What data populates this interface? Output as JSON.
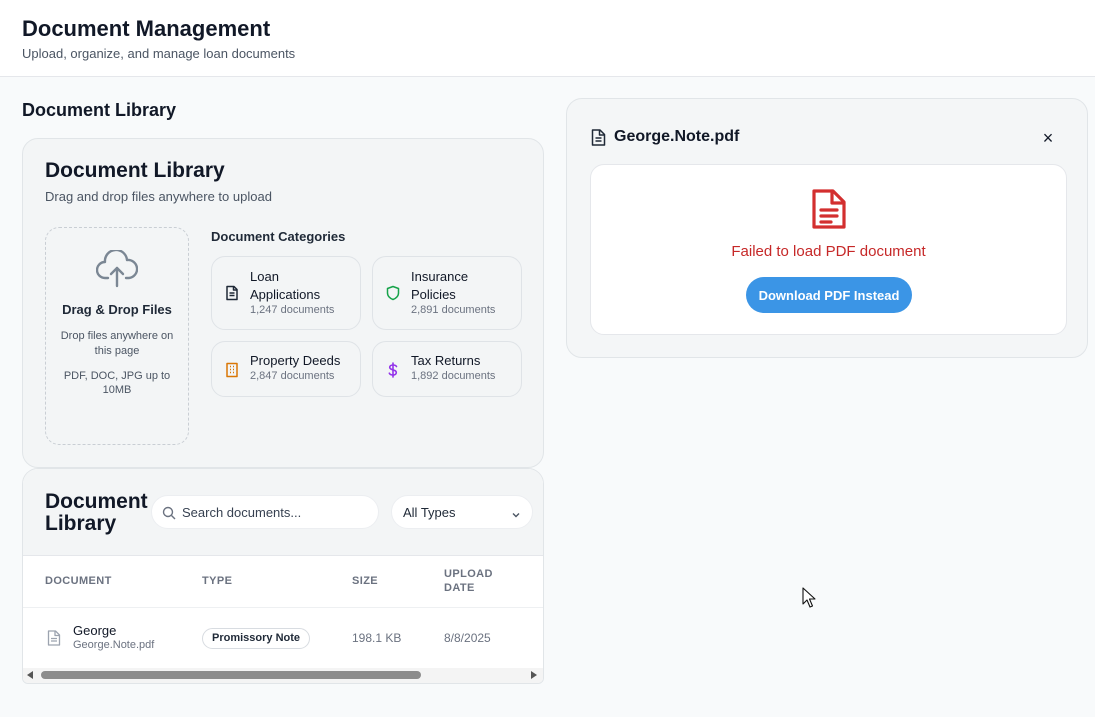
{
  "header": {
    "title": "Document Management",
    "subtitle": "Upload, organize, and manage loan documents"
  },
  "section_title": "Document Library",
  "library_card": {
    "title": "Document Library",
    "subtitle": "Drag and drop files anywhere to upload",
    "dropzone": {
      "title": "Drag & Drop Files",
      "description": "Drop files anywhere on this page",
      "formats": "PDF, DOC, JPG up to 10MB",
      "icon": "cloud-upload-icon"
    },
    "categories_title": "Document Categories",
    "categories": [
      {
        "name": "Loan Applications",
        "count": "1,247 documents",
        "icon": "document-icon",
        "color": "#1f2937"
      },
      {
        "name": "Insurance Policies",
        "count": "2,891 documents",
        "icon": "shield-icon",
        "color": "#16a34a"
      },
      {
        "name": "Property Deeds",
        "count": "2,847 documents",
        "icon": "building-icon",
        "color": "#d97706"
      },
      {
        "name": "Tax Returns",
        "count": "1,892 documents",
        "icon": "dollar-icon",
        "color": "#9333ea"
      }
    ]
  },
  "table_card": {
    "title": "Document Library",
    "search_placeholder": "Search documents...",
    "filter_value": "All Types",
    "columns": [
      "DOCUMENT",
      "TYPE",
      "SIZE",
      "UPLOAD DATE"
    ],
    "rows": [
      {
        "name": "George",
        "file": "George.Note.pdf",
        "type": "Promissory Note",
        "size": "198.1 KB",
        "date": "8/8/2025"
      }
    ]
  },
  "viewer": {
    "title": "George.Note.pdf",
    "close_label": "×",
    "error": "Failed to load PDF document",
    "download_label": "Download PDF Instead",
    "error_color": "#c62828",
    "button_color": "#3b95e6"
  }
}
